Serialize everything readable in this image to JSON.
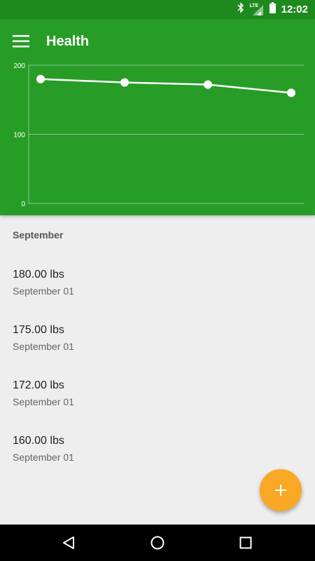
{
  "status_bar": {
    "time": "12:02",
    "network_label": "LTE"
  },
  "app": {
    "title": "Health",
    "accent": "#279d27",
    "fab_color": "#f9a825"
  },
  "chart_data": {
    "type": "line",
    "x": [
      1,
      2,
      3,
      4
    ],
    "values": [
      180,
      175,
      172,
      160
    ],
    "ylim": [
      0,
      200
    ],
    "yticks": [
      "200",
      "100",
      "0"
    ],
    "grid": true
  },
  "list": {
    "section": "September",
    "items": [
      {
        "value": "180.00 lbs",
        "date": "September 01"
      },
      {
        "value": "175.00 lbs",
        "date": "September 01"
      },
      {
        "value": "172.00 lbs",
        "date": "September 01"
      },
      {
        "value": "160.00 lbs",
        "date": "September 01"
      }
    ]
  },
  "icons": {
    "menu": "menu-icon",
    "add": "add-icon",
    "back": "back-icon",
    "home": "home-icon",
    "recents": "recents-icon"
  }
}
